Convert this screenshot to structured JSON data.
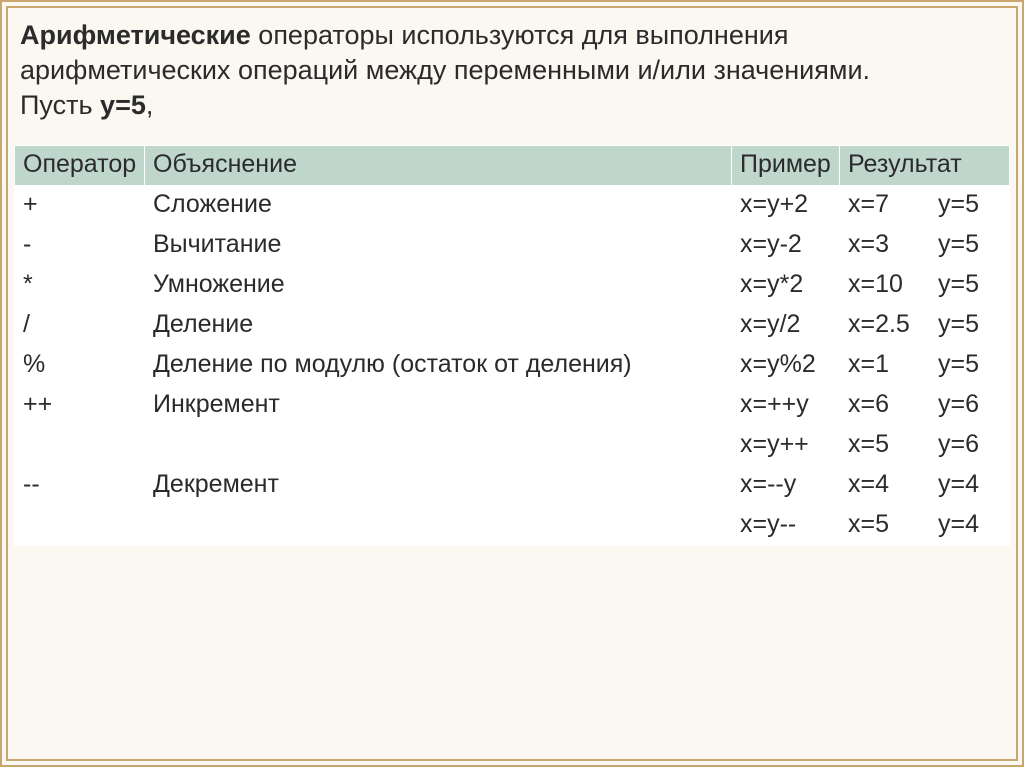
{
  "heading": {
    "bold": "Арифметические",
    "rest": " операторы используются для выполнения арифметических операций между переменными и/или значениями.",
    "line2_prefix": "Пусть ",
    "line2_bold": "y=5",
    "line2_suffix": ","
  },
  "columns": {
    "c1": "Оператор",
    "c2": "Объяснение",
    "c3": "Пример",
    "c4": "Результат",
    "c5": ""
  },
  "rows": [
    {
      "op": "+",
      "desc": "Сложение",
      "ex": "x=y+2",
      "rx": "x=7",
      "ry": "y=5"
    },
    {
      "op": "-",
      "desc": "Вычитание",
      "ex": "x=y-2",
      "rx": "x=3",
      "ry": "y=5"
    },
    {
      "op": "*",
      "desc": "Умножение",
      "ex": "x=y*2",
      "rx": "x=10",
      "ry": "y=5"
    },
    {
      "op": "/",
      "desc": "Деление",
      "ex": "x=y/2",
      "rx": "x=2.5",
      "ry": "y=5"
    },
    {
      "op": "%",
      "desc": "Деление по модулю (остаток от деления)",
      "ex": "x=y%2",
      "rx": "x=1",
      "ry": "y=5"
    },
    {
      "op": "++",
      "desc": "Инкремент",
      "ex": "x=++y",
      "rx": "x=6",
      "ry": "y=6",
      "extra": {
        "ex": "x=y++",
        "rx": "x=5",
        "ry": "y=6"
      }
    },
    {
      "op": "--",
      "desc": "Декремент",
      "ex": "x=--y",
      "rx": "x=4",
      "ry": "y=4",
      "extra": {
        "ex": "x=y--",
        "rx": "x=5",
        "ry": "y=4"
      }
    }
  ]
}
